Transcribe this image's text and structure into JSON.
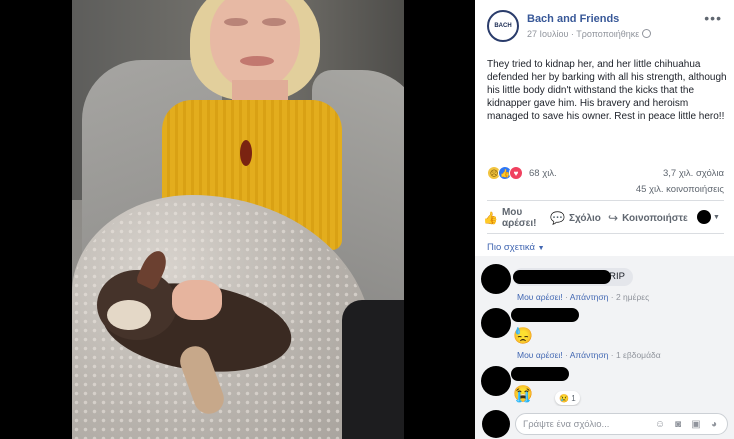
{
  "post": {
    "page_name": "Bach and Friends",
    "page_logo_text": "BACH",
    "meta_date": "27 Ιουλίου",
    "meta_sep": " · ",
    "meta_edited": "Τροποποιήθηκε",
    "text": "They tried to kidnap her, and her little chihuahua defended her by barking with all his strength, although his little body didn't withstand the kicks that the kidnapper gave him. His bravery and heroism managed to save his owner. Rest in peace little hero!!"
  },
  "reactions": {
    "count": "68 χιλ.",
    "comments": "3,7 χιλ. σχόλια",
    "shares": "45 χιλ. κοινοποιήσεις",
    "icons": [
      "sad-reaction-icon",
      "like-reaction-icon",
      "love-reaction-icon"
    ]
  },
  "actions": {
    "like_line1": "Μου",
    "like_line2": "αρέσει!",
    "comment": "Σχόλιο",
    "share": "Κοινοποιήστε"
  },
  "relevant_label": "Πιο σχετικά",
  "comments": [
    {
      "text": "RIP",
      "like": "Μου αρέσει!",
      "reply": "Απάντηση",
      "time": "2 ημέρες"
    },
    {
      "emoji": "😓",
      "like": "Μου αρέσει!",
      "reply": "Απάντηση",
      "time": "1 εβδομάδα"
    },
    {
      "emoji": "😭",
      "mini_reaction": "😢",
      "mini_count": "1"
    }
  ],
  "composer": {
    "placeholder": "Γράψτε ένα σχόλιο..."
  },
  "colors": {
    "link": "#385898",
    "meta": "#90949c",
    "text": "#1d2129"
  }
}
